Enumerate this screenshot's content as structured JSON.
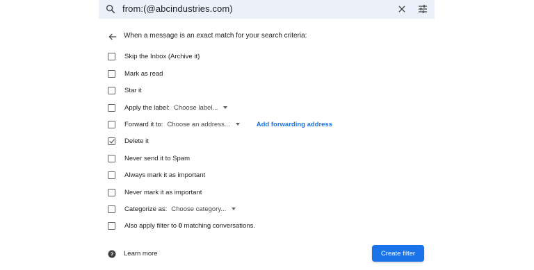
{
  "search": {
    "query": "from:(@abcindustries.com)"
  },
  "header": {
    "text": "When a message is an exact match for your search criteria:"
  },
  "options": [
    {
      "label": "Skip the Inbox (Archive it)",
      "checked": false
    },
    {
      "label": "Mark as read",
      "checked": false
    },
    {
      "label": "Star it",
      "checked": false
    },
    {
      "label": "Apply the label:",
      "checked": false,
      "select": "Choose label..."
    },
    {
      "label": "Forward it to:",
      "checked": false,
      "select": "Choose an address...",
      "link": "Add forwarding address"
    },
    {
      "label": "Delete it",
      "checked": true
    },
    {
      "label": "Never send it to Spam",
      "checked": false
    },
    {
      "label": "Always mark it as important",
      "checked": false
    },
    {
      "label": "Never mark it as important",
      "checked": false
    },
    {
      "label": "Categorize as:",
      "checked": false,
      "select": "Choose category..."
    },
    {
      "label_pre": "Also apply filter to ",
      "label_bold": "0",
      "label_post": " matching conversations.",
      "checked": false
    }
  ],
  "footer": {
    "learn_more": "Learn more",
    "create_filter": "Create filter"
  },
  "colors": {
    "accent": "#1a73e8",
    "search_bg": "#eaf1fb"
  }
}
